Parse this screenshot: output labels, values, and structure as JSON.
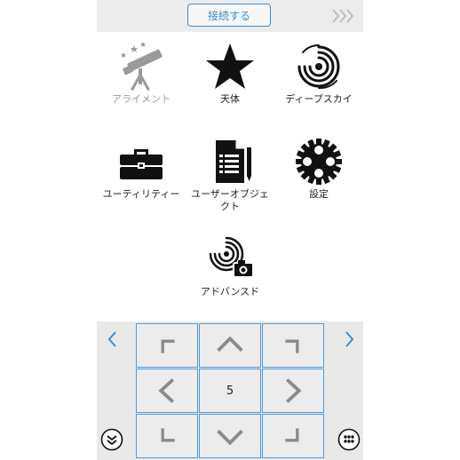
{
  "header": {
    "connect_label": "接続する",
    "chevrons_icon": "triple-chevron-right-icon"
  },
  "menu": {
    "alignment": {
      "label": "アライメント",
      "icon": "telescope-icon",
      "enabled": false
    },
    "objects": {
      "label": "天体",
      "icon": "star-icon",
      "enabled": true
    },
    "deep_sky": {
      "label": "ディープスカイ",
      "icon": "galaxy-icon",
      "enabled": true
    },
    "utility": {
      "label": "ユーティリティー",
      "icon": "toolbox-icon",
      "enabled": true
    },
    "user_objects": {
      "label": "ユーザーオブジェクト",
      "icon": "document-pen-icon",
      "enabled": true
    },
    "settings": {
      "label": "設定",
      "icon": "gear-icon",
      "enabled": true
    },
    "advanced": {
      "label": "アドバンスド",
      "icon": "galaxy-camera-icon",
      "enabled": true
    }
  },
  "pad": {
    "speed_value": "5",
    "accent_color": "#3b8ed6",
    "arrow_color": "#8a8a8a"
  }
}
